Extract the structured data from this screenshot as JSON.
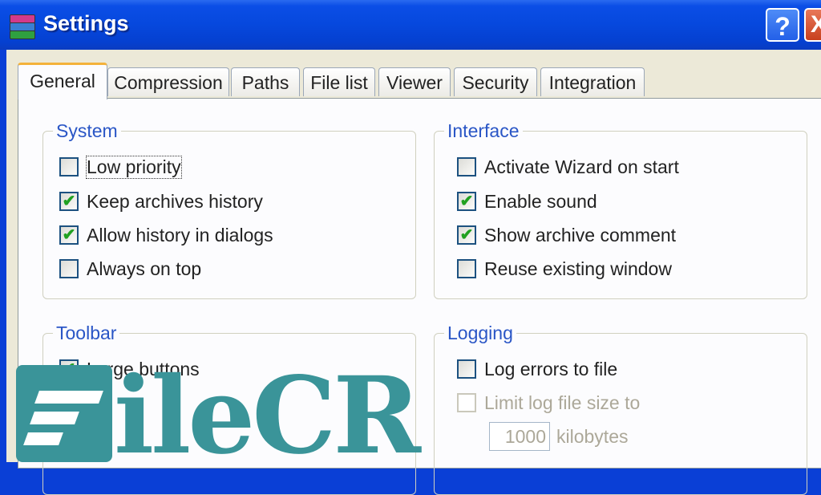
{
  "window": {
    "title": "Settings",
    "help_label": "?",
    "close_label": "X"
  },
  "tabs": [
    {
      "label": "General",
      "active": true
    },
    {
      "label": "Compression"
    },
    {
      "label": "Paths"
    },
    {
      "label": "File list"
    },
    {
      "label": "Viewer"
    },
    {
      "label": "Security"
    },
    {
      "label": "Integration"
    }
  ],
  "groups": {
    "system": {
      "title": "System",
      "items": [
        {
          "label": "Low priority",
          "checked": false
        },
        {
          "label": "Keep archives history",
          "checked": true
        },
        {
          "label": "Allow history in dialogs",
          "checked": true
        },
        {
          "label": "Always on top",
          "checked": false
        }
      ]
    },
    "interface": {
      "title": "Interface",
      "items": [
        {
          "label": "Activate Wizard on start",
          "checked": false
        },
        {
          "label": "Enable sound",
          "checked": true
        },
        {
          "label": "Show archive comment",
          "checked": true
        },
        {
          "label": "Reuse existing window",
          "checked": false
        }
      ]
    },
    "toolbar": {
      "title": "Toolbar",
      "items": [
        {
          "label": "Large buttons",
          "checked": true
        }
      ]
    },
    "logging": {
      "title": "Logging",
      "items": [
        {
          "label": "Log errors to file",
          "checked": false
        },
        {
          "label": "Limit log file size to",
          "checked": false,
          "disabled": true
        }
      ],
      "size_value": "1000",
      "size_units": "kilobytes"
    }
  },
  "watermark": {
    "text": "ileCR"
  },
  "check_glyph": "✔"
}
